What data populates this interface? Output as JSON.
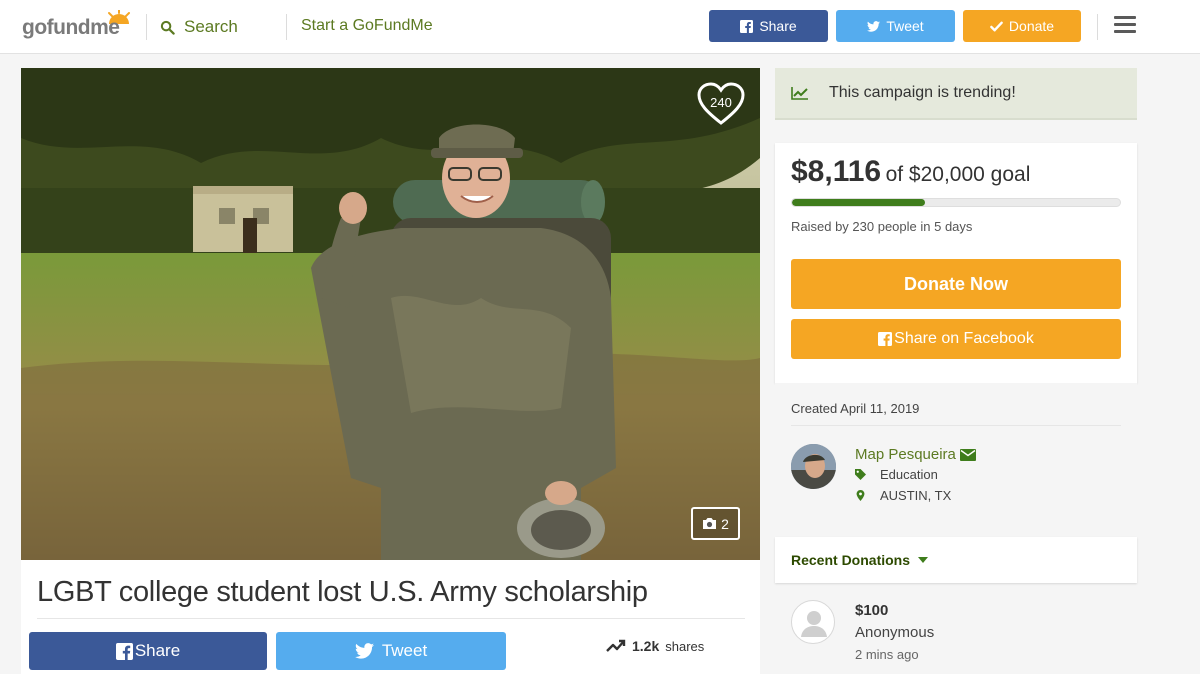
{
  "header": {
    "logo_text": "gofundme",
    "search_label": "Search",
    "start_label": "Start a GoFundMe",
    "share_label": "Share",
    "tweet_label": "Tweet",
    "donate_label": "Donate"
  },
  "hero": {
    "heart_count": "240",
    "photo_count": "2"
  },
  "campaign": {
    "title": "LGBT college student lost U.S. Army scholarship",
    "share_label": "Share",
    "tweet_label": "Tweet",
    "shares_count": "1.2k",
    "shares_label": "shares"
  },
  "sidebar": {
    "trending_text": "This campaign is trending!",
    "raised_amount": "$8,116",
    "goal_text": "of $20,000 goal",
    "progress_fraction": 0.406,
    "raised_by": "Raised by 230 people in 5 days",
    "donate_now_label": "Donate Now",
    "share_facebook_label": "Share on Facebook",
    "created": "Created April 11, 2019",
    "organizer_name": "Map Pesqueira",
    "category": "Education",
    "location": "AUSTIN, TX",
    "recent_donations_label": "Recent Donations"
  },
  "donations": [
    {
      "amount": "$100",
      "name": "Anonymous",
      "time": "2 mins ago"
    }
  ],
  "colors": {
    "brand_green": "#5c7a22",
    "facebook": "#3b5998",
    "twitter": "#55acee",
    "donate": "#f5a623",
    "progress": "#3f7d1c"
  }
}
